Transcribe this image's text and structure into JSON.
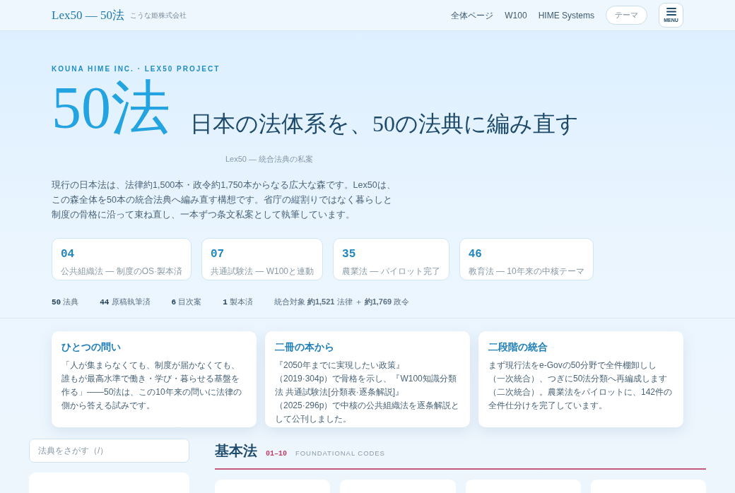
{
  "header": {
    "logo": "Lex50 — 50法",
    "company": "こうな姫株式会社",
    "nav": [
      "全体ページ",
      "W100",
      "HIME Systems"
    ],
    "theme_button": "テーマ",
    "menu_label": "MENU"
  },
  "hero": {
    "eyebrow": "KOUNA HIME INC. · LEX50 PROJECT",
    "big_title": "50法",
    "subtitle": "日本の法体系を、50の法典に編み直す",
    "tagline": "Lex50 — 統合法典の私案",
    "lead": "現行の日本法は、法律約1,500本・政令約1,750本からなる広大な森です。Lex50は、この森全体を50本の統合法典へ編み直す構想です。省庁の縦割りではなく暮らしと制度の骨格に沿って束ね直し、一本ずつ条文私案として執筆しています。"
  },
  "featured": [
    {
      "number": "04",
      "label": "公共組織法 — 制度のOS·製本済"
    },
    {
      "number": "07",
      "label": "共通試験法 — W100と連動"
    },
    {
      "number": "35",
      "label": "農業法 — パイロット完了"
    },
    {
      "number": "46",
      "label": "教育法 — 10年来の中核テーマ"
    }
  ],
  "stats": [
    {
      "value": "50",
      "label": "法典"
    },
    {
      "value": "44",
      "label": "原稿執筆済"
    },
    {
      "value": "6",
      "label": "目次案"
    },
    {
      "value": "1",
      "label": "製本済"
    }
  ],
  "scope": "統合対象 **約1,521** 法律 ＋ **約1,769** 政令",
  "intro_cards": [
    {
      "title": "ひとつの問い",
      "body": "「人が集まらなくても、制度が届かなくても、誰もが最高水準で働き・学び・暮らせる基盤を作る」——50法は、この10年来の問いに法律の側から答える試みです。"
    },
    {
      "title": "二冊の本から",
      "body": "『2050年までに実現したい政策』（2019·304p）で骨格を示し、『W100知識分類法 共通試験法[分類表·逐条解説]』（2025·296p）で中核の公共組織法を逐条解説として公刊しました。"
    },
    {
      "title": "二段階の統合",
      "body": "まず現行法をe-Govの50分野で全件棚卸しし（一次統合）、つぎに50法分類へ再編成します（二次統合）。農業法をパイロットに、142件の全件仕分けを完了しています。"
    }
  ],
  "search": {
    "placeholder": "法典をさがす（/）"
  },
  "section": {
    "title": "基本法",
    "range": "01–10",
    "subtitle": "FOUNDATIONAL CODES"
  }
}
